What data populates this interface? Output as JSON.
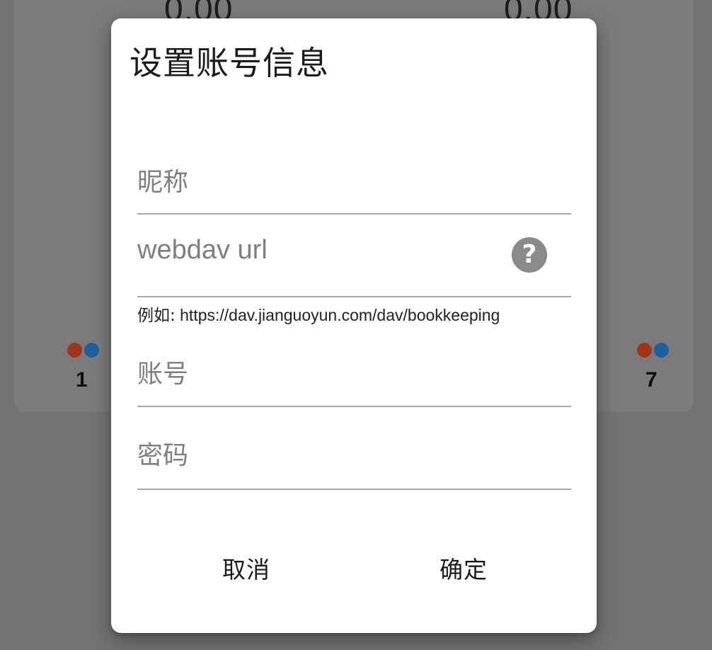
{
  "background": {
    "amount_left": "0.00",
    "amount_right": "0.00",
    "count_left": "1",
    "count_right": "7",
    "dot_colors": [
      "#a0351b",
      "#1f5f9f"
    ]
  },
  "dialog": {
    "title": "设置账号信息",
    "fields": {
      "nickname": {
        "placeholder": "昵称",
        "value": ""
      },
      "webdav_url": {
        "placeholder": "webdav url",
        "value": "",
        "help_icon": "question-circle-icon"
      },
      "url_hint_prefix": "例如:",
      "url_hint_example": " https://dav.jianguoyun.com/dav/bookkeeping",
      "account": {
        "placeholder": "账号",
        "value": ""
      },
      "password": {
        "placeholder": "密码",
        "value": ""
      }
    },
    "buttons": {
      "cancel": "取消",
      "confirm": "确定"
    },
    "help_glyph": "?"
  }
}
